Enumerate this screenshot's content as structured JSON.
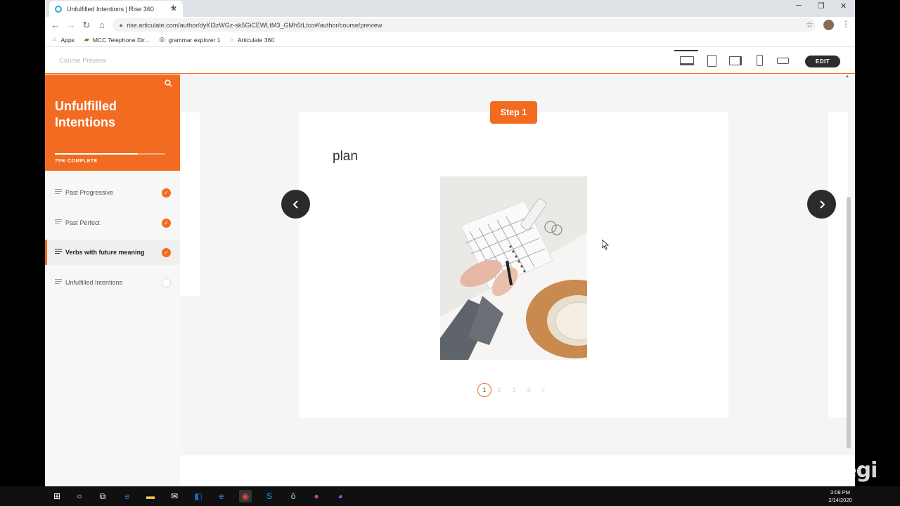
{
  "browser": {
    "tab_title": "Unfulfilled Intentions | Rise 360",
    "url": "rise.articulate.com/author/dyKI3zWGz-sk5GiCEWLtM3_GMh5tLtco#/author/course/preview",
    "bookmarks": [
      {
        "label": "Apps",
        "icon": "apps-grid-icon"
      },
      {
        "label": "MCC Telephone Dir...",
        "icon": "folder-icon"
      },
      {
        "label": "grammar explorer 1",
        "icon": "globe-icon"
      },
      {
        "label": "Articulate 360",
        "icon": "articulate-icon"
      }
    ]
  },
  "header": {
    "course_preview_label": "Course Preview",
    "edit_label": "EDIT"
  },
  "sidebar": {
    "course_title": "Unfulfilled Intentions",
    "progress_text": "75% COMPLETE",
    "progress_fraction": 0.75,
    "lessons": [
      {
        "label": "Past Progressive",
        "completed": true,
        "current": false
      },
      {
        "label": "Past Perfect",
        "completed": true,
        "current": false
      },
      {
        "label": "Verbs with future meaning",
        "completed": true,
        "current": true
      },
      {
        "label": "Unfulfilled Intentions",
        "completed": false,
        "current": false
      }
    ]
  },
  "content": {
    "step_label": "Step 1",
    "heading": "plan",
    "pagination": [
      "1",
      "2",
      "3",
      "4"
    ],
    "active_page": "1"
  },
  "taskbar": {
    "time": "3:08 PM",
    "date": "2/14/2020"
  },
  "watermark": "legi",
  "colors": {
    "accent": "#f26b21",
    "dark_button": "#2b2b2b"
  }
}
